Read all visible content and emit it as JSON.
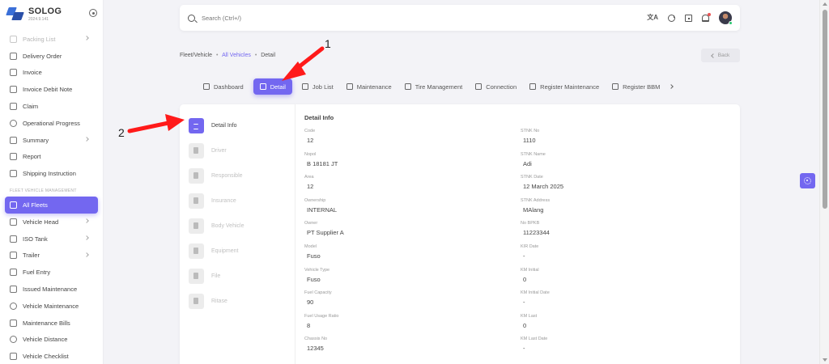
{
  "brand": {
    "name": "SOLOG",
    "version": "2024.9.141"
  },
  "sidebar": {
    "items_top": [
      {
        "label": "Packing List",
        "icon": "package-icon",
        "faded": true,
        "chevron": true
      },
      {
        "label": "Delivery Order",
        "icon": "truck-icon"
      },
      {
        "label": "Invoice",
        "icon": "file-icon"
      },
      {
        "label": "Invoice Debit Note",
        "icon": "file-icon"
      },
      {
        "label": "Claim",
        "icon": "file-icon"
      },
      {
        "label": "Operational Progress",
        "icon": "progress-icon"
      },
      {
        "label": "Summary",
        "icon": "summary-icon",
        "chevron": true
      },
      {
        "label": "Report",
        "icon": "report-icon"
      },
      {
        "label": "Shipping Instruction",
        "icon": "instruction-icon"
      }
    ],
    "section": "FLEET VEHICLE MANAGEMENT",
    "items_bottom": [
      {
        "label": "All Fleets",
        "icon": "fleet-icon",
        "active": true
      },
      {
        "label": "Vehicle Head",
        "icon": "truck-icon",
        "chevron": true
      },
      {
        "label": "ISO Tank",
        "icon": "tank-icon",
        "chevron": true
      },
      {
        "label": "Trailer",
        "icon": "trailer-icon",
        "chevron": true
      },
      {
        "label": "Fuel Entry",
        "icon": "fuel-icon"
      },
      {
        "label": "Issued Maintenance",
        "icon": "maintenance-icon"
      },
      {
        "label": "Vehicle Maintenance",
        "icon": "wrench-icon"
      },
      {
        "label": "Maintenance Bills",
        "icon": "bill-icon"
      },
      {
        "label": "Vehicle Distance",
        "icon": "distance-icon"
      },
      {
        "label": "Vehicle Checklist",
        "icon": "checklist-icon"
      }
    ]
  },
  "search": {
    "placeholder": "Search (Ctrl+/)"
  },
  "topbar": {
    "translate_glyph": "文A"
  },
  "breadcrumb": {
    "root": "Fleet/Vehicle",
    "sep": "•",
    "link": "All Vehicles",
    "current": "Detail"
  },
  "back_label": "Back",
  "tabs": [
    {
      "label": "Dashboard",
      "icon": "home-icon"
    },
    {
      "label": "Detail",
      "icon": "list-icon",
      "active": true
    },
    {
      "label": "Job List",
      "icon": "briefcase-icon"
    },
    {
      "label": "Maintenance",
      "icon": "users-icon"
    },
    {
      "label": "Tire Management",
      "icon": "tire-icon"
    },
    {
      "label": "Connection",
      "icon": "connection-icon"
    },
    {
      "label": "Register Maintenance",
      "icon": "register-icon"
    },
    {
      "label": "Register BBM",
      "icon": "fuel-icon"
    }
  ],
  "side_tabs": [
    {
      "label": "Detail Info",
      "icon": "list-icon",
      "active": true
    },
    {
      "label": "Driver",
      "icon": "user-icon"
    },
    {
      "label": "Responsible",
      "icon": "users-icon"
    },
    {
      "label": "Insurance",
      "icon": "document-icon"
    },
    {
      "label": "Body Vehicle",
      "icon": "truck-icon"
    },
    {
      "label": "Equipment",
      "icon": "tool-icon"
    },
    {
      "label": "File",
      "icon": "file-icon"
    },
    {
      "label": "Ritase",
      "icon": "chart-icon"
    }
  ],
  "detail": {
    "title": "Detail Info",
    "fields": [
      {
        "label": "Code",
        "value": "12"
      },
      {
        "label": "STNK No",
        "value": "1110"
      },
      {
        "label": "Nopol",
        "value": "B 18181 JT"
      },
      {
        "label": "STNK Name",
        "value": "Adi"
      },
      {
        "label": "Area",
        "value": "12"
      },
      {
        "label": "STNK Date",
        "value": "12 March 2025"
      },
      {
        "label": "Ownership",
        "value": "INTERNAL"
      },
      {
        "label": "STNK Address",
        "value": "MAlang"
      },
      {
        "label": "Owner",
        "value": "PT Supplier A"
      },
      {
        "label": "No BPKB",
        "value": "11223344"
      },
      {
        "label": "Model",
        "value": "Fuso"
      },
      {
        "label": "KIR Date",
        "value": "-"
      },
      {
        "label": "Vehicle Type",
        "value": "Fuso"
      },
      {
        "label": "KM Initial",
        "value": "0"
      },
      {
        "label": "Fuel Capacity",
        "value": "90"
      },
      {
        "label": "KM Initial Date",
        "value": "-"
      },
      {
        "label": "Fuel Usage Ratio",
        "value": "8"
      },
      {
        "label": "KM Last",
        "value": "0"
      },
      {
        "label": "Chassis No",
        "value": "12345"
      },
      {
        "label": "KM Last Date",
        "value": "-"
      }
    ]
  },
  "annotations": {
    "one": "1",
    "two": "2"
  },
  "colors": {
    "accent": "#7367f0",
    "arrow": "#ff1a1a",
    "badge": "#ea5455",
    "online": "#28c76f"
  }
}
